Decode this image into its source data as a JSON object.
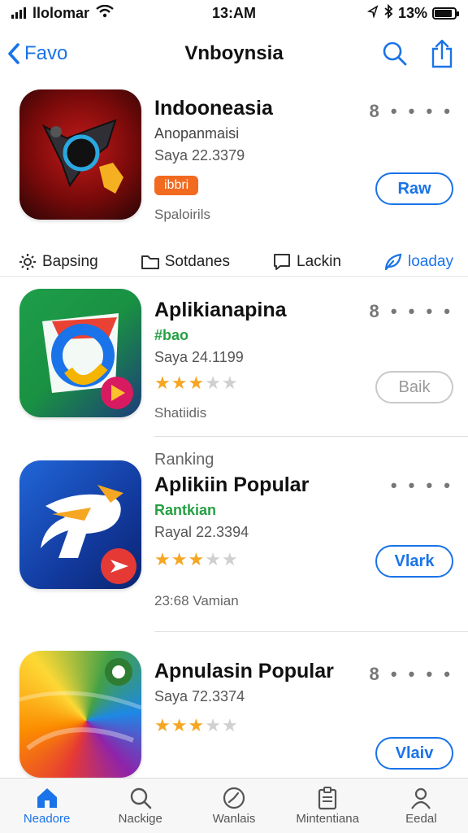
{
  "status_bar": {
    "carrier": "llolomar",
    "time": "13:AM",
    "battery_text": "13%",
    "battery_level": 0.88
  },
  "nav": {
    "back_label": "Favo",
    "title": "Vnboynsia"
  },
  "apps": [
    {
      "name": "Indooneasia",
      "subtitle": "Anopanmaisi",
      "meta": "Saya 22.3379",
      "badge": "ibbri",
      "footer": "Spaloirils",
      "button": "Raw",
      "more": "8 • • • •"
    },
    {
      "name": "Aplikianapina",
      "subtitle": "#bao",
      "meta": "Saya 24.1199",
      "rating": 2.5,
      "footer": "Shatiidis",
      "button": "Baik",
      "more": "8 • • • •"
    },
    {
      "kicker": "Ranking",
      "name": "Aplikiin Popular",
      "subtitle": "Rantkian",
      "meta": "Rayal 22.3394",
      "rating": 2.5,
      "footer": "23:68 Vamian",
      "button": "Vlark",
      "more": "• • • •"
    },
    {
      "name": "Apnulasin Popular",
      "meta": "Saya 72.3374",
      "rating": 2.5,
      "button": "Vlaiv",
      "more": "8 • • • •"
    }
  ],
  "filters": [
    {
      "label": "Bapsing",
      "icon": "gear-icon"
    },
    {
      "label": "Sotdanes",
      "icon": "folder-icon"
    },
    {
      "label": "Lackin",
      "icon": "chat-icon"
    },
    {
      "label": "loaday",
      "icon": "leaf-icon"
    }
  ],
  "tabs": [
    {
      "label": "Neadore",
      "icon": "home-icon"
    },
    {
      "label": "Nackige",
      "icon": "search-icon"
    },
    {
      "label": "Wanlais",
      "icon": "clock-icon"
    },
    {
      "label": "Mintentiana",
      "icon": "clipboard-icon"
    },
    {
      "label": "Eedal",
      "icon": "person-icon"
    }
  ],
  "colors": {
    "accent": "#1a73e8",
    "star": "#f5a623",
    "badge": "#f26a1f",
    "green_text": "#26a043"
  }
}
